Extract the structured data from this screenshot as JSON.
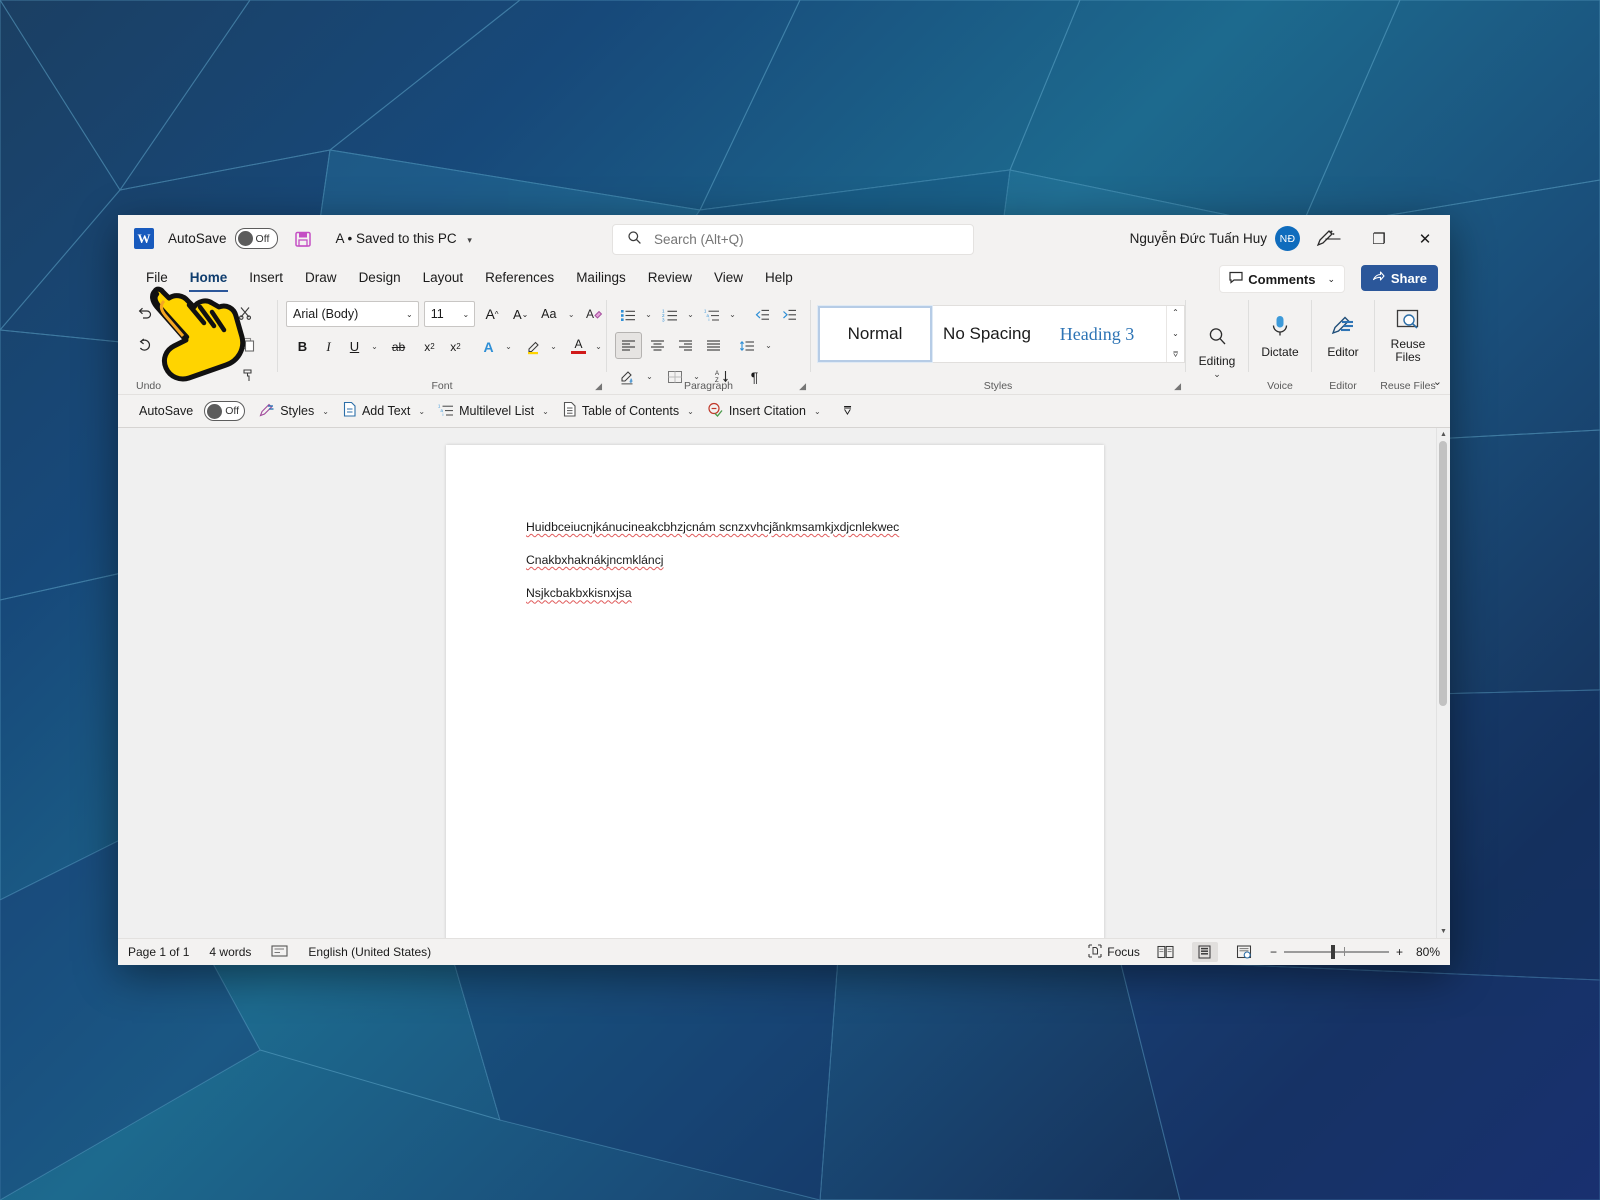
{
  "window": {
    "app": "Microsoft Word",
    "logo_letter": "W"
  },
  "titlebar": {
    "autosave_label": "AutoSave",
    "autosave_state": "Off",
    "save_icon": "save-icon",
    "document_name": "A • Saved to this PC",
    "document_caret": "▾",
    "search_placeholder": "Search (Alt+Q)",
    "search_value": "",
    "search_icon": "search-icon",
    "user_name": "Nguyễn Đức Tuấn Huy",
    "user_initials": "NĐ",
    "pen_icon": "pen-draw-icon",
    "minimize": "—",
    "maximize": "❐",
    "close": "✕"
  },
  "tabs": [
    {
      "label": "File",
      "active": false
    },
    {
      "label": "Home",
      "active": true
    },
    {
      "label": "Insert",
      "active": false
    },
    {
      "label": "Draw",
      "active": false
    },
    {
      "label": "Design",
      "active": false
    },
    {
      "label": "Layout",
      "active": false
    },
    {
      "label": "References",
      "active": false
    },
    {
      "label": "Mailings",
      "active": false
    },
    {
      "label": "Review",
      "active": false
    },
    {
      "label": "View",
      "active": false
    },
    {
      "label": "Help",
      "active": false
    }
  ],
  "tabbar": {
    "comments_label": "Comments",
    "comments_caret": "⌄",
    "share_label": "Share"
  },
  "ribbon": {
    "undo_group_label": "Undo",
    "clipboard_group_label": "",
    "font": {
      "group_label": "Font",
      "font_name": "Arial (Body)",
      "font_size": "11",
      "grow_font": "A",
      "shrink_font": "A",
      "change_case": "Aa",
      "clear_formatting": "A",
      "bold": "B",
      "italic": "I",
      "underline": "U",
      "strikethrough": "ab",
      "subscript": "x",
      "superscript": "x",
      "text_effects": "A",
      "highlight": "highlight-icon",
      "font_color": "A"
    },
    "paragraph": {
      "group_label": "Paragraph",
      "bullets": "bullets-icon",
      "numbering": "numbering-icon",
      "multilevel": "multilevel-list-icon",
      "decrease_indent": "decrease-indent-icon",
      "increase_indent": "increase-indent-icon",
      "align_left": "align-left-icon",
      "align_center": "align-center-icon",
      "align_right": "align-right-icon",
      "justify": "justify-icon",
      "line_spacing": "line-spacing-icon",
      "shading": "shading-icon",
      "borders": "borders-icon",
      "sort": "sort-icon",
      "show_marks": "¶"
    },
    "styles": {
      "group_label": "Styles",
      "items": [
        {
          "label": "Normal",
          "selected": true
        },
        {
          "label": "No Spacing",
          "selected": false
        },
        {
          "label": "Heading 3",
          "selected": false
        }
      ]
    },
    "editing": {
      "label": "Editing",
      "icon": "search-magnifier-icon",
      "caret": "⌄"
    },
    "voice": {
      "group_label": "Voice",
      "label": "Dictate",
      "icon": "microphone-icon"
    },
    "editor": {
      "group_label": "Editor",
      "label": "Editor",
      "icon": "editor-pen-icon"
    },
    "reuse": {
      "group_label": "Reuse Files",
      "label": "Reuse\nFiles",
      "label_line1": "Reuse",
      "label_line2": "Files",
      "icon": "reuse-files-icon"
    },
    "collapse_icon": "chevron-down-icon"
  },
  "toolbar2": {
    "items": [
      {
        "label": "AutoSave",
        "icon": "toggle-off-icon",
        "caret": "",
        "state": "Off"
      },
      {
        "label": "Styles",
        "icon": "styles-icon",
        "caret": "⌄"
      },
      {
        "label": "Add Text",
        "icon": "add-text-icon",
        "caret": "⌄"
      },
      {
        "label": "Multilevel List",
        "icon": "multilevel-list-icon",
        "caret": "⌄"
      },
      {
        "label": "Table of Contents",
        "icon": "table-of-contents-icon",
        "caret": "⌄"
      },
      {
        "label": "Insert Citation",
        "icon": "insert-citation-icon",
        "caret": "⌄"
      }
    ],
    "overflow": "⩢"
  },
  "document": {
    "lines": [
      "Huidbceiucnjkánucineakcbhzjcnám scnzxvhcjãnkmsamkjxdjcnlekwec",
      "Cnakbxhaknákjncmkláncj",
      "Nsjkcbakbxkisnxjsa"
    ]
  },
  "statusbar": {
    "page": "Page 1 of 1",
    "words": "4 words",
    "proofing_icon": "proofing-errors-icon",
    "language": "English (United States)",
    "focus_label": "Focus",
    "focus_icon": "focus-icon",
    "view_read": "read-mode-icon",
    "view_print": "print-layout-icon",
    "view_web": "web-layout-icon",
    "zoom_out": "−",
    "zoom_in": "+",
    "zoom_level": "80%"
  },
  "cursor": {
    "icon": "hand-pointer-cursor"
  },
  "colors": {
    "accent": "#2b579a",
    "avatar": "#0f6cbd",
    "word_blue": "#185abd",
    "spell_error": "#e05b5b",
    "highlight_yellow": "#ffd400"
  }
}
